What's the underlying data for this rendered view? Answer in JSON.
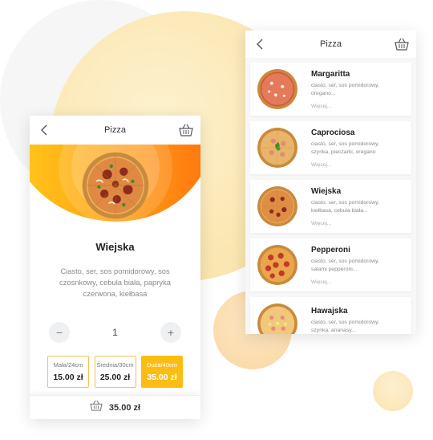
{
  "detail_screen": {
    "header_title": "Pizza",
    "pizza_name": "Wiejska",
    "description": "Ciasto, ser, sos pomidorowy, sos czosnkowy, cebula biała, papryka czerwona, kiełbasa",
    "quantity": "1",
    "minus_label": "−",
    "plus_label": "+",
    "sizes": [
      {
        "label": "Mała/24cm",
        "price": "15.00 zł",
        "selected": false
      },
      {
        "label": "Średnia/30cm",
        "price": "25.00 zł",
        "selected": false
      },
      {
        "label": "Duża/40cm",
        "price": "35.00 zł",
        "selected": true
      }
    ],
    "cart_total": "35.00 zł"
  },
  "menu_screen": {
    "header_title": "Pizza",
    "items": [
      {
        "name": "Margaritta",
        "desc": "ciasto, ser, sos pomidorowy, oregano...",
        "more": "Więcej..."
      },
      {
        "name": "Caprociosa",
        "desc": "ciasto, ser, sos pomidorowy, szynka, pieczarki, oregano",
        "more": "Więcej..."
      },
      {
        "name": "Wiejska",
        "desc": "ciasto, ser, sos pomidorowy, kiełbasa, cebula biała...",
        "more": "Więcej..."
      },
      {
        "name": "Pepperoni",
        "desc": "ciasto, ser, sos pomidorowy, salami pepperoni...",
        "more": "Więcej..."
      },
      {
        "name": "Hawajska",
        "desc": "ciasto, ser, sos pomidorowy, szynka, ananasy...",
        "more": ""
      }
    ]
  },
  "colors": {
    "accent": "#fbbd13",
    "hero_orange": "#ff8a12",
    "text_dark": "#222222",
    "text_muted": "#888888"
  },
  "icons": [
    "back-arrow-icon",
    "basket-icon",
    "pizza-image"
  ]
}
